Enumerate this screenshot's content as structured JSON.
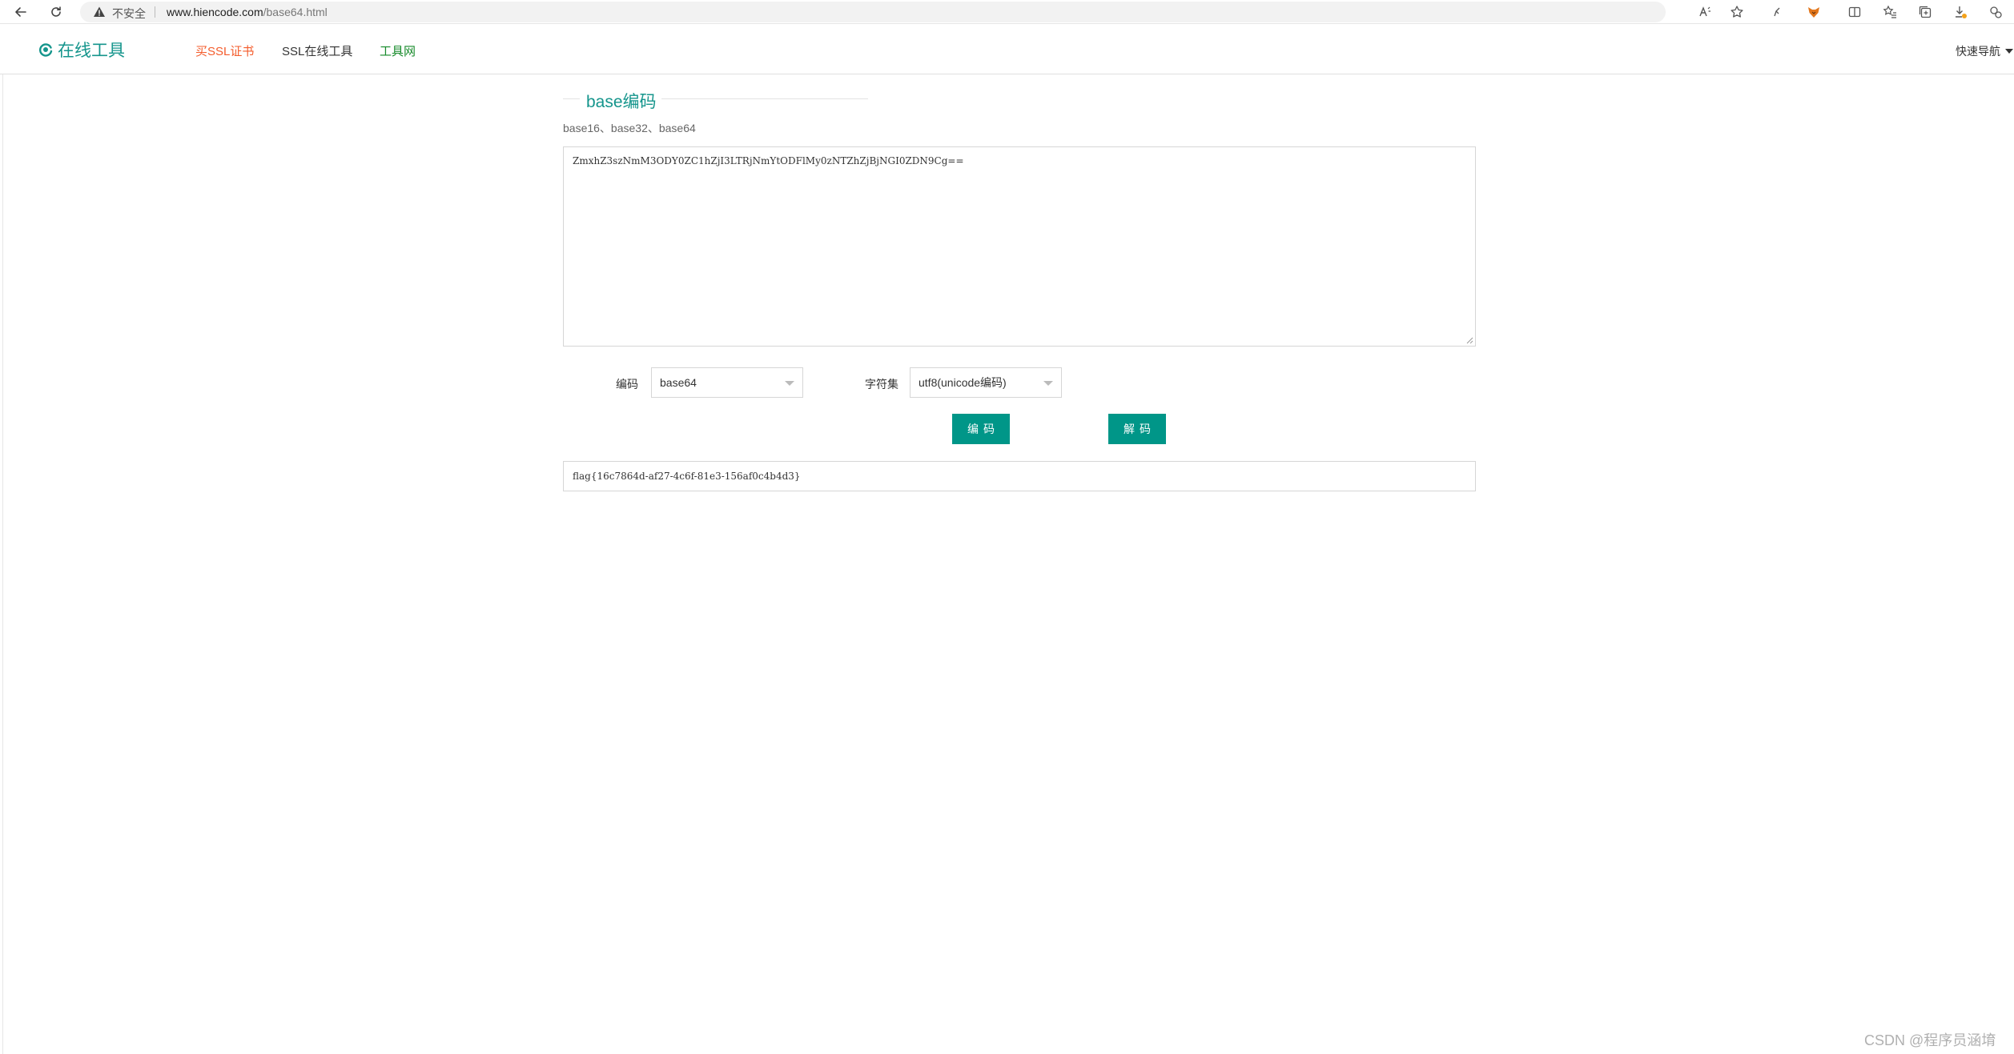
{
  "browser": {
    "insecure_label": "不安全",
    "url_host": "www.hiencode.com",
    "url_path": "/base64.html"
  },
  "header": {
    "logo_text": "在线工具",
    "nav": {
      "buy_ssl": "买SSL证书",
      "ssl_tools": "SSL在线工具",
      "tool_site": "工具网"
    },
    "quick_nav": "快速导航"
  },
  "main": {
    "title": "base编码",
    "subtitle": "base16、base32、base64",
    "input_text": "ZmxhZ3szNmM3ODY0ZC1hZjI3LTRjNmYtODFlMy0zNTZhZjBjNGI0ZDN9Cg==",
    "encode_label": "编码",
    "encode_value": "base64",
    "charset_label": "字符集",
    "charset_value": "utf8(unicode编码)",
    "encode_button": "编码",
    "decode_button": "解码",
    "output_text": "flag{16c7864d-af27-4c6f-81e3-156af0c4b4d3}"
  },
  "watermark": "CSDN @程序员涵堉",
  "colors": {
    "accent": "#009688",
    "brand": "#15958c",
    "nav_ssl": "#f45c2c",
    "nav_site": "#168a2a"
  }
}
